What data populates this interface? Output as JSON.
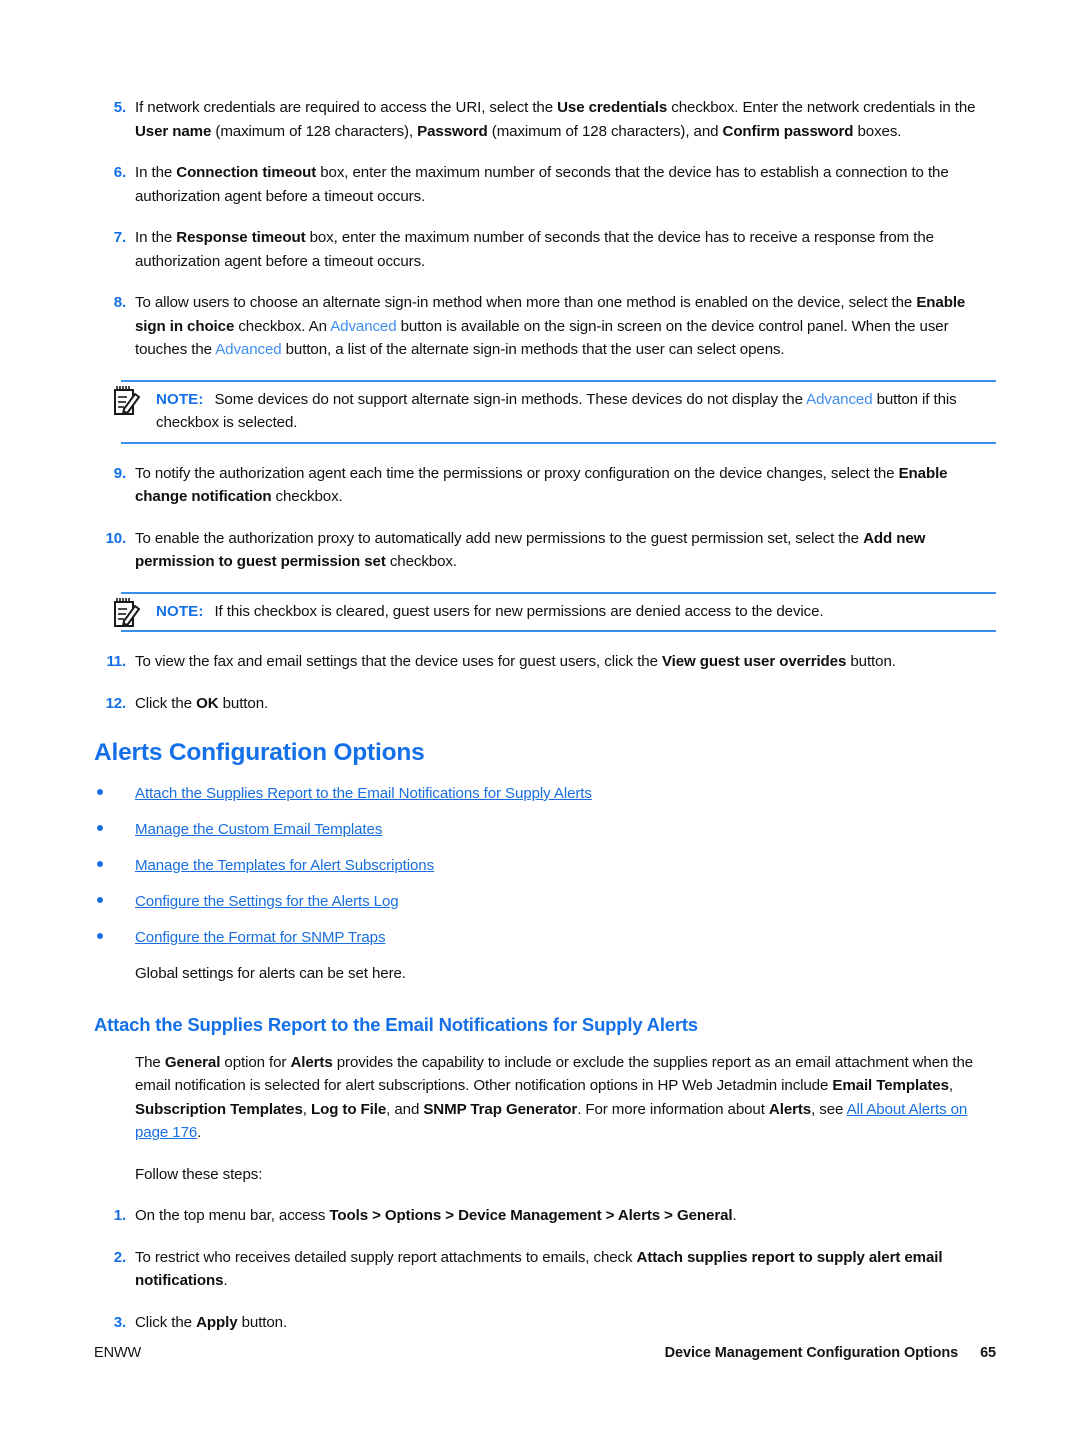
{
  "document": {
    "title": "Device Management Configuration Options"
  },
  "steps_continued": [
    {
      "number": "5.",
      "segments": [
        {
          "t": "If network credentials are required to access the URI, select the ",
          "s": "normal"
        },
        {
          "t": "Use credentials",
          "s": "bold"
        },
        {
          "t": " checkbox. Enter the network credentials in the ",
          "s": "normal"
        },
        {
          "t": "User name",
          "s": "bold"
        },
        {
          "t": " (maximum of 128 characters), ",
          "s": "normal"
        },
        {
          "t": "Password",
          "s": "bold"
        },
        {
          "t": " (maximum of 128 characters), and ",
          "s": "normal"
        },
        {
          "t": "Confirm password",
          "s": "bold"
        },
        {
          "t": " boxes.",
          "s": "normal"
        }
      ]
    },
    {
      "number": "6.",
      "segments": [
        {
          "t": "In the ",
          "s": "normal"
        },
        {
          "t": "Connection timeout",
          "s": "bold"
        },
        {
          "t": " box, enter the maximum number of seconds that the device has to establish a connection to the authorization agent before a timeout occurs.",
          "s": "normal"
        }
      ]
    },
    {
      "number": "7.",
      "segments": [
        {
          "t": "In the ",
          "s": "normal"
        },
        {
          "t": "Response timeout",
          "s": "bold"
        },
        {
          "t": " box, enter the maximum number of seconds that the device has to receive a response from the authorization agent before a timeout occurs.",
          "s": "normal"
        }
      ]
    },
    {
      "number": "8.",
      "segments": [
        {
          "t": "To allow users to choose an alternate sign-in method when more than one method is enabled on the device, select the ",
          "s": "normal"
        },
        {
          "t": "Enable sign in choice",
          "s": "bold"
        },
        {
          "t": " checkbox. An ",
          "s": "normal"
        },
        {
          "t": "Advanced",
          "s": "link-plain"
        },
        {
          "t": " button is available on the sign-in screen on the device control panel. When the user touches the ",
          "s": "normal"
        },
        {
          "t": "Advanced",
          "s": "link-plain"
        },
        {
          "t": " button, a list of the alternate sign-in methods that the user can select opens.",
          "s": "normal"
        }
      ]
    }
  ],
  "note_1": {
    "icon": "note-pad-pencil-icon",
    "label": "NOTE:",
    "segments": [
      {
        "t": "Some devices do not support alternate sign-in methods. These devices do not display the ",
        "s": "normal"
      },
      {
        "t": "Advanced",
        "s": "link-plain"
      },
      {
        "t": " button if this checkbox is selected.",
        "s": "normal"
      }
    ]
  },
  "steps_continued_2": [
    {
      "number": "9.",
      "segments": [
        {
          "t": "To notify the authorization agent each time the permissions or proxy configuration on the device changes, select the ",
          "s": "normal"
        },
        {
          "t": "Enable change notification",
          "s": "bold"
        },
        {
          "t": " checkbox.",
          "s": "normal"
        }
      ]
    },
    {
      "number": "10.",
      "segments": [
        {
          "t": "To enable the authorization proxy to automatically add new permissions to the guest permission set, select the ",
          "s": "normal"
        },
        {
          "t": "Add new permission to guest permission set",
          "s": "bold"
        },
        {
          "t": " checkbox.",
          "s": "normal"
        }
      ]
    }
  ],
  "note_2": {
    "icon": "note-pad-pencil-icon",
    "label": "NOTE:",
    "segments": [
      {
        "t": "If this checkbox is cleared, guest users for new permissions are denied access to the device.",
        "s": "normal"
      }
    ]
  },
  "steps_continued_3": [
    {
      "number": "11.",
      "segments": [
        {
          "t": "To view the fax and email settings that the device uses for guest users, click the ",
          "s": "normal"
        },
        {
          "t": "View guest user overrides",
          "s": "bold"
        },
        {
          "t": " button.",
          "s": "normal"
        }
      ]
    },
    {
      "number": "12.",
      "segments": [
        {
          "t": "Click the ",
          "s": "normal"
        },
        {
          "t": "OK",
          "s": "bold"
        },
        {
          "t": " button.",
          "s": "normal"
        }
      ]
    }
  ],
  "section_alerts": {
    "heading": "Alerts Configuration Options",
    "links": [
      "Attach the Supplies Report to the Email Notifications for Supply Alerts",
      "Manage the Custom Email Templates",
      "Manage the Templates for Alert Subscriptions",
      "Configure the Settings for the Alerts Log",
      "Configure the Format for SNMP Traps"
    ],
    "intro": "Global settings for alerts can be set here."
  },
  "section_attach": {
    "heading": "Attach the Supplies Report to the Email Notifications for Supply Alerts",
    "paragraph": [
      {
        "t": "The ",
        "s": "normal"
      },
      {
        "t": "General",
        "s": "bold"
      },
      {
        "t": " option for ",
        "s": "normal"
      },
      {
        "t": "Alerts",
        "s": "bold"
      },
      {
        "t": " provides the capability to include or exclude the supplies report as an email attachment when the email notification is selected for alert subscriptions. Other notification options in HP Web Jetadmin include ",
        "s": "normal"
      },
      {
        "t": "Email Templates",
        "s": "bold"
      },
      {
        "t": ", ",
        "s": "normal"
      },
      {
        "t": "Subscription Templates",
        "s": "bold"
      },
      {
        "t": ", ",
        "s": "normal"
      },
      {
        "t": "Log to File",
        "s": "bold"
      },
      {
        "t": ", and ",
        "s": "normal"
      },
      {
        "t": "SNMP Trap Generator",
        "s": "bold"
      },
      {
        "t": ". For more information about ",
        "s": "normal"
      },
      {
        "t": "Alerts",
        "s": "bold"
      },
      {
        "t": ", see ",
        "s": "normal"
      },
      {
        "t": "All About Alerts on page 176",
        "s": "link"
      },
      {
        "t": ".",
        "s": "normal"
      }
    ],
    "follow_label": "Follow these steps:",
    "steps": [
      {
        "number": "1.",
        "segments": [
          {
            "t": "On the top menu bar, access ",
            "s": "normal"
          },
          {
            "t": "Tools > Options > Device Management > Alerts > General",
            "s": "bold"
          },
          {
            "t": ".",
            "s": "normal"
          }
        ]
      },
      {
        "number": "2.",
        "segments": [
          {
            "t": "To restrict who receives detailed supply report attachments to emails, check ",
            "s": "normal"
          },
          {
            "t": "Attach supplies report to supply alert email notifications",
            "s": "bold"
          },
          {
            "t": ".",
            "s": "normal"
          }
        ]
      },
      {
        "number": "3.",
        "segments": [
          {
            "t": "Click the ",
            "s": "normal"
          },
          {
            "t": "Apply",
            "s": "bold"
          },
          {
            "t": " button.",
            "s": "normal"
          }
        ]
      }
    ]
  },
  "footer": {
    "left": "ENWW",
    "chapter": "Device Management Configuration Options",
    "page": "65"
  },
  "colors": {
    "heading_blue": "#1470e8",
    "link_blue": "#1a6fe0",
    "inline_blue": "#3e8ef0",
    "rule_blue": "#3e8ef0",
    "body_black": "#141414"
  }
}
